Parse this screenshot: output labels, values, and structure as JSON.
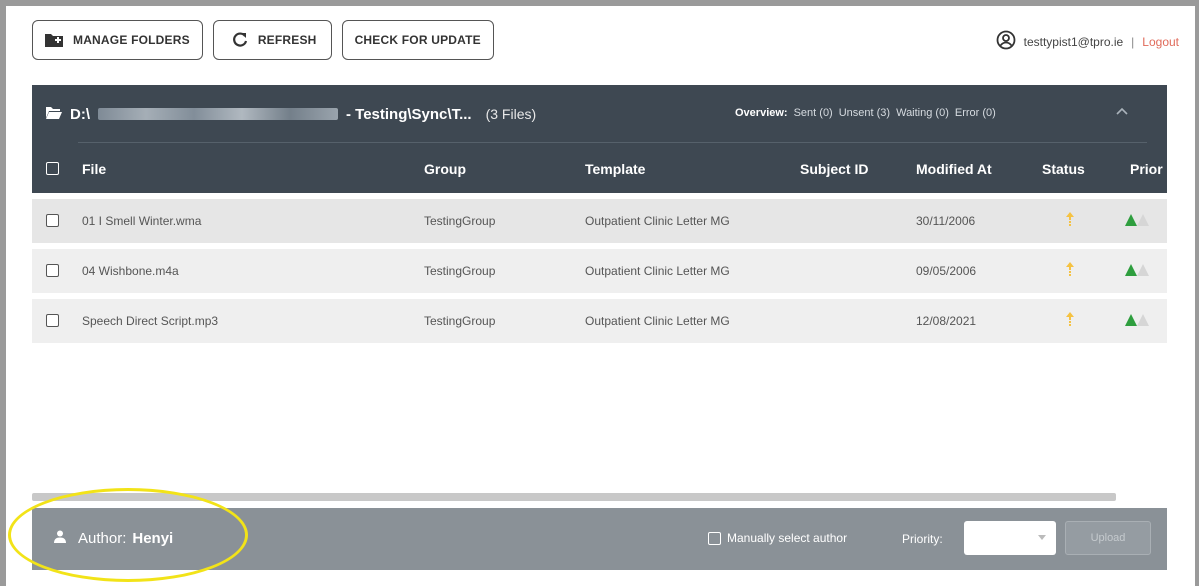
{
  "toolbar": {
    "manage_folders": "MANAGE FOLDERS",
    "refresh": "REFRESH",
    "check_update": "CHECK FOR UPDATE"
  },
  "user": {
    "email": "testtypist1@tpro.ie",
    "separator": "|",
    "logout": "Logout"
  },
  "panel": {
    "path_prefix": "D:\\",
    "path_suffix": "- Testing\\Sync\\T...",
    "file_count": "(3 Files)",
    "overview_label": "Overview:",
    "overview_items": [
      "Sent (0)",
      "Unsent (3)",
      "Waiting (0)",
      "Error (0)"
    ]
  },
  "columns": [
    "File",
    "Group",
    "Template",
    "Subject ID",
    "Modified At",
    "Status",
    "Prior"
  ],
  "rows": [
    {
      "file": "01 I Smell Winter.wma",
      "group": "TestingGroup",
      "template": "Outpatient Clinic Letter MG",
      "subject_id": "",
      "modified": "30/11/2006"
    },
    {
      "file": "04 Wishbone.m4a",
      "group": "TestingGroup",
      "template": "Outpatient Clinic Letter MG",
      "subject_id": "",
      "modified": "09/05/2006"
    },
    {
      "file": "Speech Direct Script.mp3",
      "group": "TestingGroup",
      "template": "Outpatient Clinic Letter MG",
      "subject_id": "",
      "modified": "12/08/2021"
    }
  ],
  "footer": {
    "author_label": "Author:",
    "author_name": "Henyi",
    "manual_select": "Manually select author",
    "priority_label": "Priority:",
    "upload": "Upload"
  },
  "colors": {
    "header_bg": "#3e4852",
    "footer_bg": "#8a9197",
    "status_arrow": "#f5c242",
    "priority_green": "#2e9e3e",
    "logout": "#e06a5a",
    "highlight": "#f2e318"
  },
  "icons": [
    "folder-plus-icon",
    "refresh-icon",
    "user-circle-icon",
    "folder-open-icon",
    "chevron-up-icon",
    "status-arrow-icon",
    "priority-triangle-icon",
    "person-icon",
    "chevron-down-icon"
  ]
}
